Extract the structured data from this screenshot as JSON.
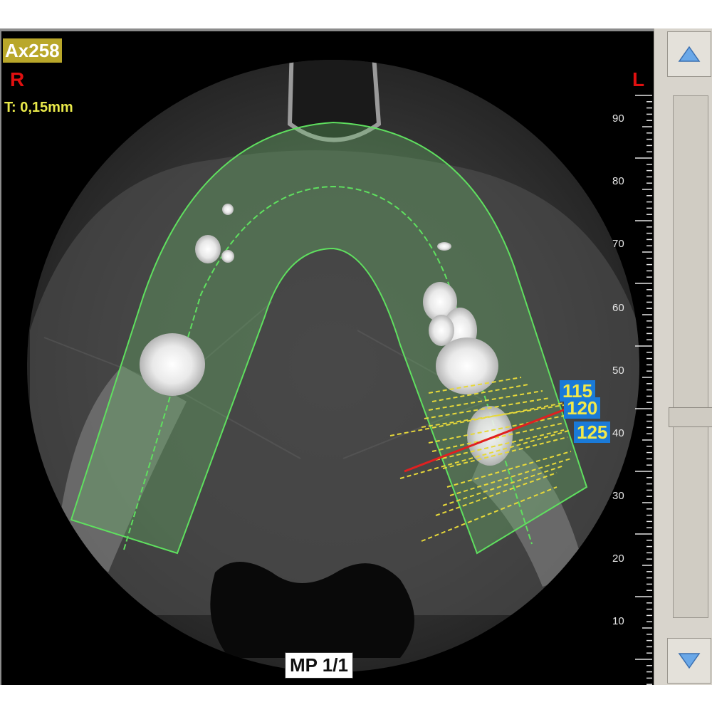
{
  "viewer": {
    "series_label": "Ax258",
    "orientation_right": "R",
    "orientation_left": "L",
    "slice_thickness": "T: 0,15mm",
    "panoramic_label": "MP 1/1"
  },
  "ruler": {
    "tick_labels": [
      "90",
      "80",
      "70",
      "60",
      "50",
      "40",
      "30",
      "20",
      "10"
    ]
  },
  "cross_sections": {
    "labels": [
      "115",
      "120",
      "125"
    ],
    "active_label": "120"
  },
  "scrollbar": {
    "up_icon": "triangle-up-icon",
    "down_icon": "triangle-down-icon",
    "thumb_position": 0.59
  },
  "colors": {
    "series_badge": "#b9a72a",
    "orientation": "#e01010",
    "thickness_text": "#e9e94a",
    "arch_outline": "#5fe05f",
    "cross_section_lines": "#e6d83a",
    "active_line": "#e02020",
    "slice_tag_bg": "#1a7ad8",
    "slice_tag_text": "#f2e84a"
  }
}
